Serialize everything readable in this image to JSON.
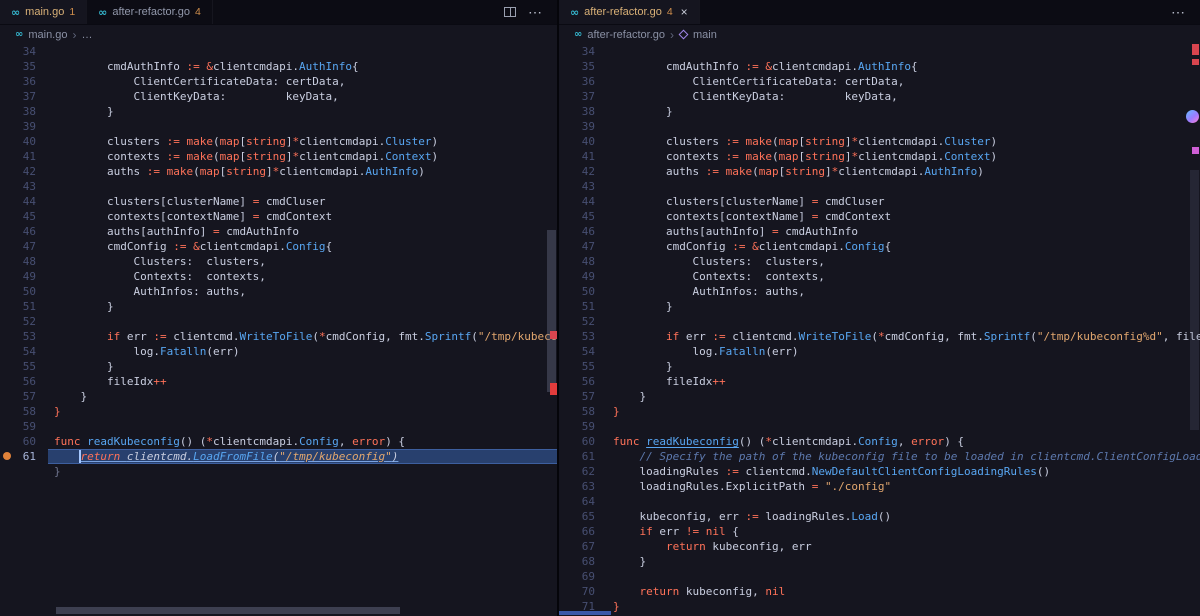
{
  "icons": {
    "go_glyph": "∞",
    "more_actions": "⋯",
    "close": "×",
    "chevron": "›"
  },
  "colors": {
    "editor_background": "#15151f",
    "tabbar_background": "#0c0c14",
    "keyword": "#ff7259",
    "string": "#e2a76f",
    "type_function": "#58a6f2",
    "comment": "#5d79ae",
    "modified_tab_label": "#d8b077",
    "problems_badge": "#cf8e4c",
    "go_icon": "#35b5cc",
    "selection_background": "#28406e",
    "error_mark": "#e23c3c",
    "breakpoint": "#e0823a"
  },
  "left_group": {
    "tabs": [
      {
        "label": "main.go",
        "badge": "1"
      },
      {
        "label": "after-refactor.go",
        "badge": "4"
      }
    ],
    "breadcrumb": {
      "file": "main.go",
      "tail": "…"
    }
  },
  "right_group": {
    "tabs": [
      {
        "label": "after-refactor.go",
        "badge": "4"
      }
    ],
    "breadcrumb": {
      "file": "after-refactor.go",
      "symbol": "main"
    }
  },
  "code": {
    "shared_lines": [
      {
        "n": 34,
        "t": []
      },
      {
        "n": 35,
        "t": [
          [
            "        cmdAuthInfo "
          ],
          [
            ":= ",
            "kw"
          ],
          [
            "&",
            "kw"
          ],
          [
            "clientcmdapi."
          ],
          [
            "AuthInfo",
            "typ"
          ],
          [
            "{"
          ]
        ]
      },
      {
        "n": 36,
        "t": [
          [
            "            ClientCertificateData: certData,"
          ]
        ]
      },
      {
        "n": 37,
        "t": [
          [
            "            ClientKeyData:         keyData,"
          ]
        ]
      },
      {
        "n": 38,
        "t": [
          [
            "        }"
          ]
        ]
      },
      {
        "n": 39,
        "t": []
      },
      {
        "n": 40,
        "t": [
          [
            "        clusters "
          ],
          [
            ":= ",
            "kw"
          ],
          [
            "make",
            "kw"
          ],
          [
            "("
          ],
          [
            "map",
            "kw"
          ],
          [
            "["
          ],
          [
            "string",
            "kw"
          ],
          [
            "]"
          ],
          [
            "*",
            "kw"
          ],
          [
            "clientcmdapi."
          ],
          [
            "Cluster",
            "typ"
          ],
          [
            ")"
          ]
        ]
      },
      {
        "n": 41,
        "t": [
          [
            "        contexts "
          ],
          [
            ":= ",
            "kw"
          ],
          [
            "make",
            "kw"
          ],
          [
            "("
          ],
          [
            "map",
            "kw"
          ],
          [
            "["
          ],
          [
            "string",
            "kw"
          ],
          [
            "]"
          ],
          [
            "*",
            "kw"
          ],
          [
            "clientcmdapi."
          ],
          [
            "Context",
            "typ"
          ],
          [
            ")"
          ]
        ]
      },
      {
        "n": 42,
        "t": [
          [
            "        auths "
          ],
          [
            ":= ",
            "kw"
          ],
          [
            "make",
            "kw"
          ],
          [
            "("
          ],
          [
            "map",
            "kw"
          ],
          [
            "["
          ],
          [
            "string",
            "kw"
          ],
          [
            "]"
          ],
          [
            "*",
            "kw"
          ],
          [
            "clientcmdapi."
          ],
          [
            "AuthInfo",
            "typ"
          ],
          [
            ")"
          ]
        ]
      },
      {
        "n": 43,
        "t": []
      },
      {
        "n": 44,
        "t": [
          [
            "        clusters[clusterName] "
          ],
          [
            "= ",
            "kw"
          ],
          [
            "cmdCluser"
          ]
        ]
      },
      {
        "n": 45,
        "t": [
          [
            "        contexts[contextName] "
          ],
          [
            "= ",
            "kw"
          ],
          [
            "cmdContext"
          ]
        ]
      },
      {
        "n": 46,
        "t": [
          [
            "        auths[authInfo] "
          ],
          [
            "= ",
            "kw"
          ],
          [
            "cmdAuthInfo"
          ]
        ]
      },
      {
        "n": 47,
        "t": [
          [
            "        cmdConfig "
          ],
          [
            ":= ",
            "kw"
          ],
          [
            "&",
            "kw"
          ],
          [
            "clientcmdapi."
          ],
          [
            "Config",
            "typ"
          ],
          [
            "{"
          ]
        ]
      },
      {
        "n": 48,
        "t": [
          [
            "            Clusters:  clusters,"
          ]
        ]
      },
      {
        "n": 49,
        "t": [
          [
            "            Contexts:  contexts,"
          ]
        ]
      },
      {
        "n": 50,
        "t": [
          [
            "            AuthInfos: auths,"
          ]
        ]
      },
      {
        "n": 51,
        "t": [
          [
            "        }"
          ]
        ]
      },
      {
        "n": 52,
        "t": []
      },
      {
        "n": 53,
        "t": [
          [
            "        "
          ],
          [
            "if ",
            "kw"
          ],
          [
            "err "
          ],
          [
            ":= ",
            "kw"
          ],
          [
            "clientcmd."
          ],
          [
            "WriteToFile",
            "typ"
          ],
          [
            "("
          ],
          [
            "*",
            "kw"
          ],
          [
            "cmdConfig, fmt."
          ],
          [
            "Sprintf",
            "typ"
          ],
          [
            "("
          ],
          [
            "\"/tmp/kubeconfig%d\"",
            "str"
          ],
          [
            ", fileIdx)); err "
          ],
          [
            "!= ",
            "kw"
          ],
          [
            "nil",
            "kw"
          ],
          [
            " {"
          ]
        ]
      },
      {
        "n": 54,
        "t": [
          [
            "            log."
          ],
          [
            "Fatalln",
            "typ"
          ],
          [
            "(err)"
          ]
        ]
      },
      {
        "n": 55,
        "t": [
          [
            "        }"
          ]
        ]
      },
      {
        "n": 56,
        "t": [
          [
            "        fileIdx"
          ],
          [
            "++",
            "kw"
          ]
        ]
      },
      {
        "n": 57,
        "t": [
          [
            "    }"
          ]
        ]
      },
      {
        "n": 58,
        "t": [
          [
            "}",
            "kw"
          ]
        ]
      },
      {
        "n": 59,
        "t": []
      }
    ],
    "left_extra": [
      {
        "n": 60,
        "t": [
          [
            "func ",
            "kw"
          ],
          [
            "readKubeconfig",
            "typ"
          ],
          [
            "() ("
          ],
          [
            "*",
            "kw"
          ],
          [
            "clientcmdapi."
          ],
          [
            "Config",
            "typ"
          ],
          [
            ", "
          ],
          [
            "error",
            "kw"
          ],
          [
            ") {"
          ]
        ]
      },
      {
        "n": 61,
        "sel": true,
        "cursor": true,
        "bp": true,
        "t": [
          [
            "    ",
            "ws"
          ],
          [
            "return ",
            "kw"
          ],
          [
            "clientcmd."
          ],
          [
            "LoadFromFile",
            "typ"
          ],
          [
            "("
          ],
          [
            "\"/tmp/kubeconfig\"",
            "str"
          ],
          [
            ")"
          ]
        ]
      },
      {
        "n": "",
        "t": [
          [
            "}",
            "dim"
          ]
        ]
      }
    ],
    "right_extra": [
      {
        "n": 60,
        "t": [
          [
            "func ",
            "kw"
          ],
          [
            "readKubeconfig",
            "typ u"
          ],
          [
            "() ("
          ],
          [
            "*",
            "kw"
          ],
          [
            "clientcmdapi."
          ],
          [
            "Config",
            "typ"
          ],
          [
            ", "
          ],
          [
            "error",
            "kw"
          ],
          [
            ") {"
          ]
        ]
      },
      {
        "n": 61,
        "t": [
          [
            "    "
          ],
          [
            "// Specify the path of the kubeconfig file to be loaded in clientcmd.ClientConfigLoadingRules",
            "cm"
          ]
        ]
      },
      {
        "n": 62,
        "t": [
          [
            "    loadingRules "
          ],
          [
            ":= ",
            "kw"
          ],
          [
            "clientcmd."
          ],
          [
            "NewDefaultClientConfigLoadingRules",
            "typ"
          ],
          [
            "()"
          ]
        ]
      },
      {
        "n": 63,
        "t": [
          [
            "    loadingRules.ExplicitPath "
          ],
          [
            "= ",
            "kw"
          ],
          [
            "\"./config\"",
            "str"
          ]
        ]
      },
      {
        "n": 64,
        "t": []
      },
      {
        "n": 65,
        "t": [
          [
            "    kubeconfig, err "
          ],
          [
            ":= ",
            "kw"
          ],
          [
            "loadingRules."
          ],
          [
            "Load",
            "typ"
          ],
          [
            "()"
          ]
        ]
      },
      {
        "n": 66,
        "t": [
          [
            "    "
          ],
          [
            "if ",
            "kw"
          ],
          [
            "err "
          ],
          [
            "!= ",
            "kw"
          ],
          [
            "nil",
            "kw"
          ],
          [
            " {"
          ]
        ]
      },
      {
        "n": 67,
        "t": [
          [
            "        "
          ],
          [
            "return ",
            "kw"
          ],
          [
            "kubeconfig, err"
          ]
        ]
      },
      {
        "n": 68,
        "t": [
          [
            "    }"
          ]
        ]
      },
      {
        "n": 69,
        "t": []
      },
      {
        "n": 70,
        "t": [
          [
            "    "
          ],
          [
            "return ",
            "kw"
          ],
          [
            "kubeconfig, "
          ],
          [
            "nil",
            "kw"
          ]
        ]
      },
      {
        "n": 71,
        "t": [
          [
            "}",
            "kw"
          ]
        ]
      }
    ]
  }
}
